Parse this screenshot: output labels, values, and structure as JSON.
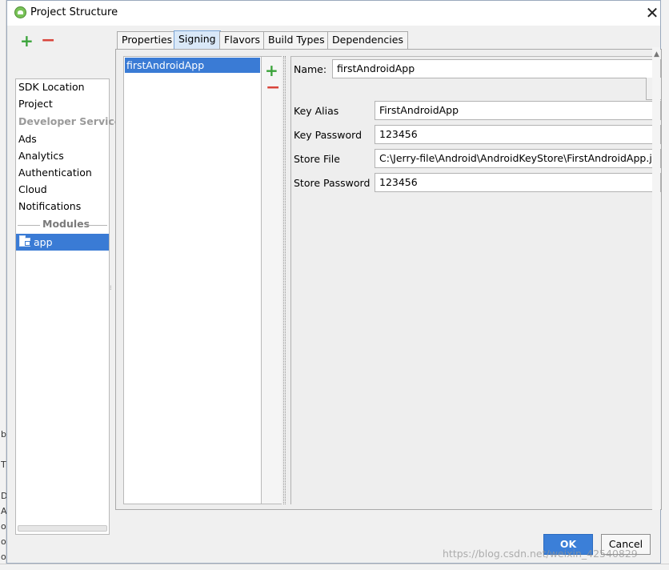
{
  "window": {
    "title": "Project Structure"
  },
  "left_panel": {
    "add_label": "+",
    "remove_label": "−",
    "items": [
      "SDK Location",
      "Project"
    ],
    "section_header": "Developer Services",
    "services": [
      "Ads",
      "Analytics",
      "Authentication",
      "Cloud",
      "Notifications"
    ],
    "modules_header": "Modules",
    "modules": [
      "app"
    ]
  },
  "tabs": {
    "items": [
      "Properties",
      "Signing",
      "Flavors",
      "Build Types",
      "Dependencies"
    ],
    "active": "Signing"
  },
  "signing": {
    "configs": [
      "firstAndroidApp"
    ],
    "add_label": "+",
    "remove_label": "−",
    "form": {
      "name_label": "Name:",
      "name_value": "firstAndroidApp",
      "key_alias_label": "Key Alias",
      "key_alias_value": "FirstAndroidApp",
      "key_password_label": "Key Password",
      "key_password_value": "123456",
      "store_file_label": "Store File",
      "store_file_value": "C:\\Jerry-file\\Android\\AndroidKeyStore\\FirstAndroidApp.jk",
      "store_password_label": "Store Password",
      "store_password_value": "123456"
    }
  },
  "buttons": {
    "ok": "OK",
    "cancel": "Cancel"
  },
  "background_fragments": [
    "b",
    "T",
    "D",
    "A",
    "o",
    "o",
    "o"
  ],
  "watermark": "https://blog.csdn.net/weixin_42540829",
  "colors": {
    "selection": "#3a7bd5",
    "add": "#3aa33a",
    "remove": "#d9453b",
    "active_tab": "#d9e8f8"
  }
}
